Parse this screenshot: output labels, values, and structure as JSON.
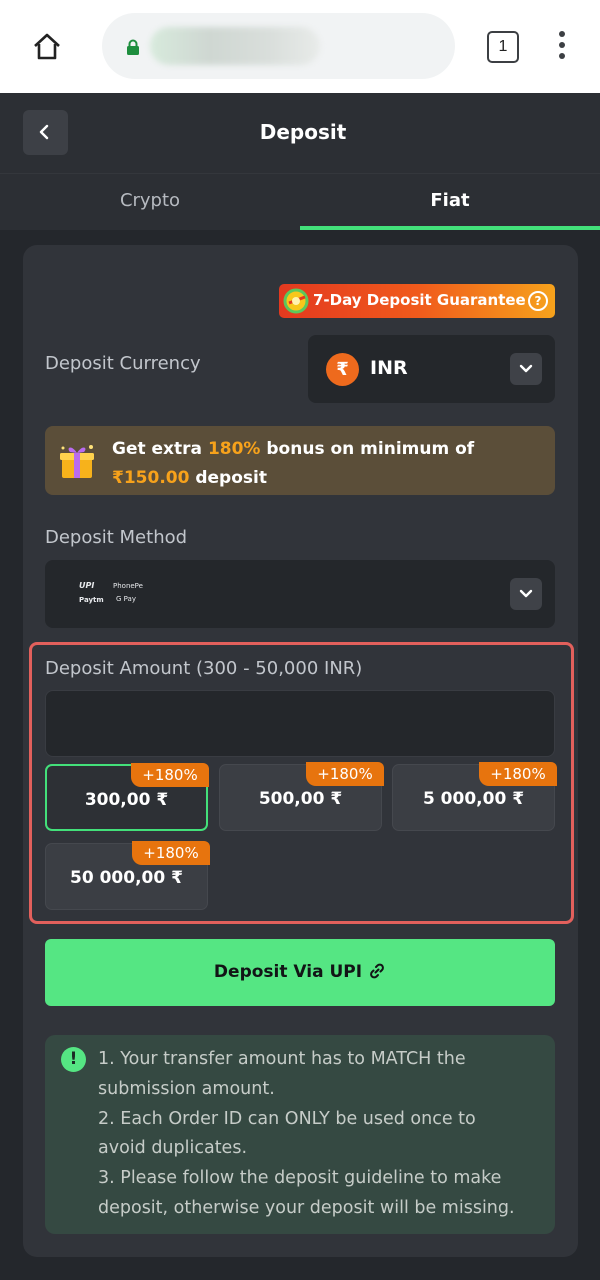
{
  "browser": {
    "tab_count": "1"
  },
  "header": {
    "title": "Deposit"
  },
  "tabs": [
    {
      "label": "Crypto",
      "active": false
    },
    {
      "label": "Fiat",
      "active": true
    }
  ],
  "guarantee": {
    "label": "7-Day Deposit Guarantee",
    "help": "?"
  },
  "currency": {
    "label": "Deposit Currency",
    "symbol": "₹",
    "value": "INR"
  },
  "bonus": {
    "prefix": "Get extra ",
    "percent": "180%",
    "middle": " bonus on minimum of ",
    "minimum": "₹150.00",
    "suffix": " deposit"
  },
  "method": {
    "label": "Deposit Method",
    "logos": [
      "UPI",
      "PhonePe",
      "Paytm",
      "G Pay"
    ]
  },
  "amount": {
    "label": "Deposit Amount (300 - 50,000 INR)",
    "value": "",
    "presets": [
      {
        "value": "300,00 ₹",
        "badge": "+180%",
        "selected": true
      },
      {
        "value": "500,00 ₹",
        "badge": "+180%",
        "selected": false
      },
      {
        "value": "5 000,00 ₹",
        "badge": "+180%",
        "selected": false
      },
      {
        "value": "50 000,00 ₹",
        "badge": "+180%",
        "selected": false
      }
    ]
  },
  "submit": {
    "label": "Deposit Via UPI"
  },
  "notice": {
    "icon": "!",
    "lines": [
      "1. Your transfer amount has to MATCH the",
      "submission amount.",
      "2. Each Order ID can ONLY be used once to",
      "avoid duplicates.",
      "3. Please follow the deposit guideline to make",
      "deposit, otherwise your deposit will be missing."
    ]
  },
  "colors": {
    "accent_green": "#43e07a",
    "button_green": "#55e683",
    "highlight_orange": "#f7a21b",
    "alert_red": "#e2605c"
  }
}
